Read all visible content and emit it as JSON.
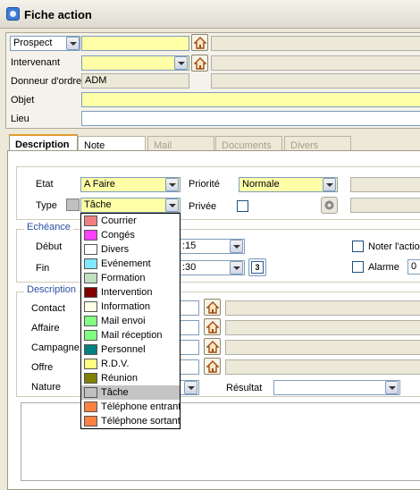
{
  "window": {
    "title": "Fiche action"
  },
  "header": {
    "prospect_select": "Prospect",
    "prospect_value": "",
    "intervenant_label": "Intervenant",
    "intervenant_value": "",
    "donneur_label": "Donneur d'ordre",
    "donneur_value": "ADM",
    "objet_label": "Objet",
    "objet_value": "",
    "lieu_label": "Lieu",
    "lieu_value": ""
  },
  "tabs": [
    "Description",
    "Note",
    "Mail",
    "Documents",
    "Divers"
  ],
  "form": {
    "etat_label": "Etat",
    "etat_value": "A Faire",
    "priorite_label": "Priorité",
    "priorite_value": "Normale",
    "type_label": "Type",
    "type_value": "Tâche",
    "privee_label": "Privée",
    "echeance_title": "Echéance",
    "debut_label": "Début",
    "debut_time": ":15",
    "fin_label": "Fin",
    "fin_time": ":30",
    "calendar_badge": "3",
    "noter_label": "Noter l'action",
    "alarme_label": "Alarme",
    "alarme_value": "0",
    "description_title": "Description",
    "contact_label": "Contact",
    "affaire_label": "Affaire",
    "campagne_label": "Campagne",
    "offre_label": "Offre",
    "nature_label": "Nature",
    "resultat_label": "Résultat",
    "resultat_value": ""
  },
  "type_options": [
    {
      "label": "Courrier",
      "color": "#f08080"
    },
    {
      "label": "Congés",
      "color": "#ff40ff"
    },
    {
      "label": "Divers",
      "color": "#ffffff"
    },
    {
      "label": "Evénement",
      "color": "#80e8ff"
    },
    {
      "label": "Formation",
      "color": "#c0e0c0"
    },
    {
      "label": "Intervention",
      "color": "#800000"
    },
    {
      "label": "Information",
      "color": "#ffffe8"
    },
    {
      "label": "Mail envoi",
      "color": "#80ff80"
    },
    {
      "label": "Mail réception",
      "color": "#80ff80"
    },
    {
      "label": "Personnel",
      "color": "#008080"
    },
    {
      "label": "R.D.V.",
      "color": "#ffff80"
    },
    {
      "label": "Réunion",
      "color": "#808000"
    },
    {
      "label": "Tâche",
      "color": "#c0c0c0"
    },
    {
      "label": "Téléphone entrant",
      "color": "#ff8040"
    },
    {
      "label": "Téléphone sortant",
      "color": "#ff8040"
    }
  ],
  "type_selected_index": 12,
  "colors": {
    "type_swatch": "#c0c0c0",
    "accent_tab": "#e09a2c",
    "group_title": "#2b50a0",
    "field_yellow": "#ffffa8"
  }
}
